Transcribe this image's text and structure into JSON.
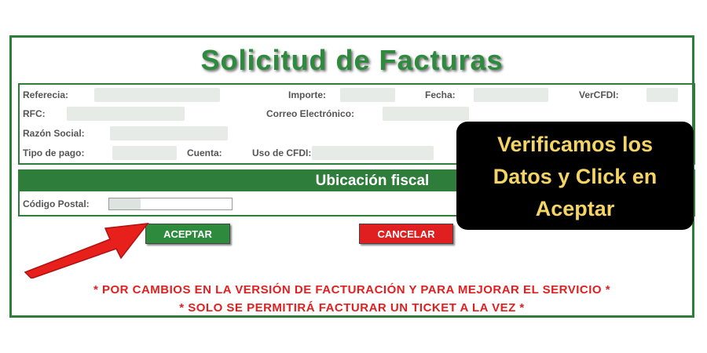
{
  "form": {
    "title": "Solicitud de Facturas",
    "labels": {
      "referencia": "Referecia:",
      "importe": "Importe:",
      "fecha": "Fecha:",
      "vercfdi": "VerCFDI:",
      "rfc": "RFC:",
      "correo": "Correo Electrónico:",
      "razon": "Razón Social:",
      "tipo_pago": "Tipo de pago:",
      "cuenta": "Cuenta:",
      "uso_cfdi": "Uso de CFDI:"
    },
    "ubicacion": {
      "title": "Ubicación fiscal",
      "codigo_postal_label": "Código Postal:"
    },
    "buttons": {
      "accept": "ACEPTAR",
      "cancel": "CANCELAR"
    },
    "notice": [
      "* POR CAMBIOS EN LA VERSIÓN DE FACTURACIÓN Y PARA MEJORAR EL SERVICIO *",
      "* SOLO SE PERMITIRÁ FACTURAR UN TICKET A LA VEZ *"
    ]
  },
  "callout": {
    "lines": [
      "Verificamos los",
      "Datos y Click en",
      "Aceptar"
    ]
  },
  "colors": {
    "green": "#2e7d3a",
    "red": "#e02020",
    "callout_bg": "#000000",
    "callout_text": "#f5d466"
  }
}
